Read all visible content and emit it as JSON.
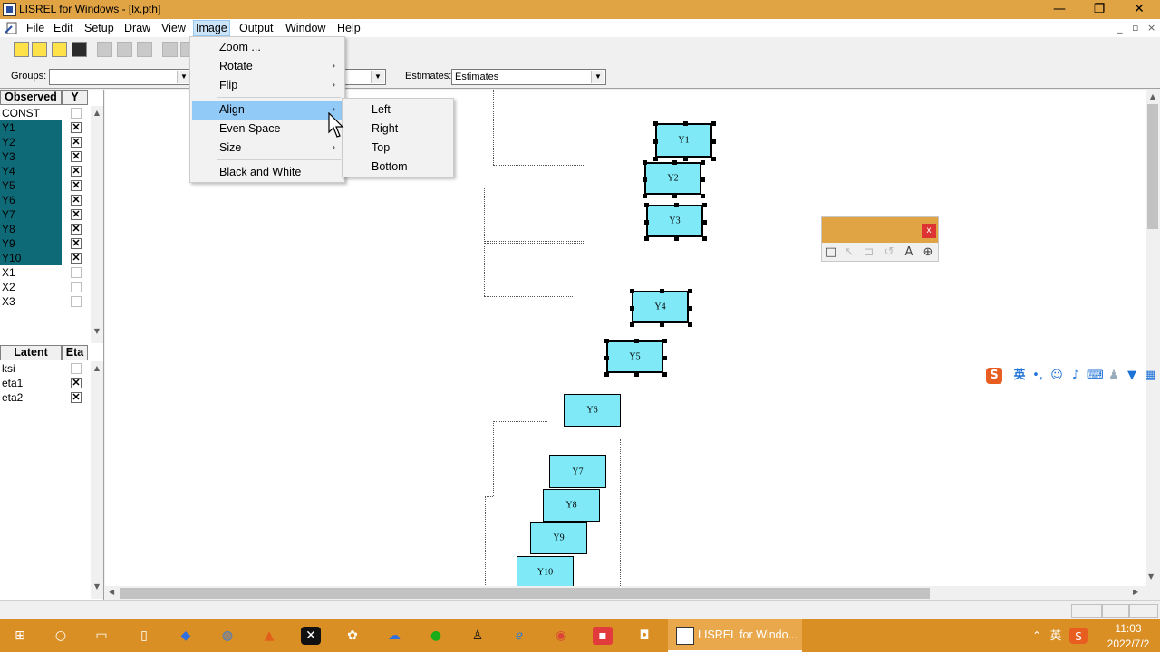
{
  "window": {
    "title": "LISREL for Windows - [lx.pth]",
    "controls": {
      "minimize": "—",
      "restore": "❐",
      "close": "✕"
    }
  },
  "menubar": {
    "items": [
      "File",
      "Edit",
      "Setup",
      "Draw",
      "View",
      "Image",
      "Output",
      "Window",
      "Help"
    ],
    "active": "Image",
    "mdi_controls": [
      "_",
      "▫",
      "×"
    ]
  },
  "groupsbar": {
    "groups_label": "Groups:",
    "groups_value": "",
    "middle_value": "",
    "estimates_label": "Estimates:",
    "estimates_value": "Estimates"
  },
  "observed_panel": {
    "header_name": "Observed",
    "header_flag": "Y",
    "rows": [
      {
        "name": "CONST",
        "checked": false,
        "selected": false
      },
      {
        "name": "Y1",
        "checked": true,
        "selected": true
      },
      {
        "name": "Y2",
        "checked": true,
        "selected": true
      },
      {
        "name": "Y3",
        "checked": true,
        "selected": true
      },
      {
        "name": "Y4",
        "checked": true,
        "selected": true
      },
      {
        "name": "Y5",
        "checked": true,
        "selected": true
      },
      {
        "name": "Y6",
        "checked": true,
        "selected": true
      },
      {
        "name": "Y7",
        "checked": true,
        "selected": true
      },
      {
        "name": "Y8",
        "checked": true,
        "selected": true
      },
      {
        "name": "Y9",
        "checked": true,
        "selected": true
      },
      {
        "name": "Y10",
        "checked": true,
        "selected": true
      },
      {
        "name": "X1",
        "checked": false,
        "selected": false
      },
      {
        "name": "X2",
        "checked": false,
        "selected": false
      },
      {
        "name": "X3",
        "checked": false,
        "selected": false
      }
    ]
  },
  "latent_panel": {
    "header_name": "Latent",
    "header_flag": "Eta",
    "rows": [
      {
        "name": "ksi",
        "checked": false
      },
      {
        "name": "eta1",
        "checked": true
      },
      {
        "name": "eta2",
        "checked": true
      }
    ]
  },
  "check_mark": "✕",
  "image_menu": {
    "items": [
      {
        "label": "Zoom ...",
        "submenu": false
      },
      {
        "label": "Rotate",
        "submenu": true
      },
      {
        "label": "Flip",
        "submenu": true
      },
      {
        "label": "Align",
        "submenu": true,
        "highlighted": true
      },
      {
        "label": "Even Space",
        "submenu": true
      },
      {
        "label": "Size",
        "submenu": true
      },
      {
        "label": "Black and White",
        "submenu": false
      }
    ],
    "submenu_arrow": "›"
  },
  "align_submenu": {
    "items": [
      "Left",
      "Right",
      "Top",
      "Bottom"
    ]
  },
  "diagram": {
    "node_color": "#7fe9f7",
    "nodes": [
      {
        "label": "Y1",
        "selected": true
      },
      {
        "label": "Y2",
        "selected": true
      },
      {
        "label": "Y3",
        "selected": true
      },
      {
        "label": "Y4",
        "selected": true
      },
      {
        "label": "Y5",
        "selected": true
      },
      {
        "label": "Y6",
        "selected": false
      },
      {
        "label": "Y7",
        "selected": false
      },
      {
        "label": "Y8",
        "selected": false
      },
      {
        "label": "Y9",
        "selected": false
      },
      {
        "label": "Y10",
        "selected": false
      }
    ]
  },
  "draw_toolbar": {
    "close_label": "x",
    "tools": [
      "rectangle-icon",
      "arrow-icon",
      "box-icon",
      "undo-icon",
      "text-icon",
      "zoom-icon"
    ],
    "text_tool_label": "A"
  },
  "ime_bar": {
    "logo": "S",
    "lang": "英",
    "punct": "•,"
  },
  "taskbar": {
    "active_app": "LISREL for Windo...",
    "tray_lang": "英",
    "time": "11:03",
    "date": "2022/7/2"
  },
  "colors": {
    "titlebar": "#e0a445",
    "taskbar": "#d98f24",
    "selection_teal": "#0f6a78",
    "menu_highlight": "#91c9f7"
  }
}
